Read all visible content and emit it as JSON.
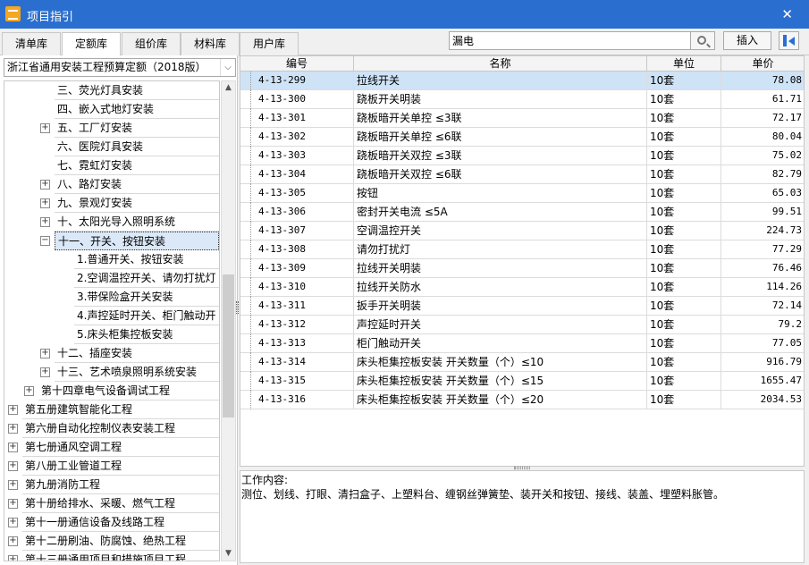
{
  "window": {
    "title": "项目指引"
  },
  "tabs": [
    {
      "label": "清单库",
      "active": false
    },
    {
      "label": "定额库",
      "active": true
    },
    {
      "label": "组价库",
      "active": false
    },
    {
      "label": "材料库",
      "active": false
    },
    {
      "label": "用户库",
      "active": false
    }
  ],
  "search": {
    "value": "漏电"
  },
  "toolbar": {
    "insert_label": "插入"
  },
  "library_select": {
    "value": "浙江省通用安装工程预算定额（2018版）"
  },
  "tree": [
    {
      "label": "三、荧光灯具安装",
      "expander": ""
    },
    {
      "label": "四、嵌入式地灯安装",
      "expander": ""
    },
    {
      "label": "五、工厂灯安装",
      "expander": "+"
    },
    {
      "label": "六、医院灯具安装",
      "expander": ""
    },
    {
      "label": "七、霓虹灯安装",
      "expander": ""
    },
    {
      "label": "八、路灯安装",
      "expander": "+"
    },
    {
      "label": "九、景观灯安装",
      "expander": "+"
    },
    {
      "label": "十、太阳光导入照明系统",
      "expander": "+"
    },
    {
      "label": "十一、开关、按钮安装",
      "expander": "−",
      "selected": true
    },
    {
      "label": "1.普通开关、按钮安装",
      "expander": ""
    },
    {
      "label": "2.空调温控开关、请勿打扰灯",
      "expander": ""
    },
    {
      "label": "3.带保险盒开关安装",
      "expander": ""
    },
    {
      "label": "4.声控延时开关、柜门触动开",
      "expander": ""
    },
    {
      "label": "5.床头柜集控板安装",
      "expander": ""
    },
    {
      "label": "十二、插座安装",
      "expander": "+"
    },
    {
      "label": "十三、艺术喷泉照明系统安装",
      "expander": "+"
    },
    {
      "label": "第十四章电气设备调试工程",
      "expander": "+"
    },
    {
      "label": "第五册建筑智能化工程",
      "expander": "+"
    },
    {
      "label": "第六册自动化控制仪表安装工程",
      "expander": "+"
    },
    {
      "label": "第七册通风空调工程",
      "expander": "+"
    },
    {
      "label": "第八册工业管道工程",
      "expander": "+"
    },
    {
      "label": "第九册消防工程",
      "expander": "+"
    },
    {
      "label": "第十册给排水、采暖、燃气工程",
      "expander": "+"
    },
    {
      "label": "第十一册通信设备及线路工程",
      "expander": "+"
    },
    {
      "label": "第十二册刷油、防腐蚀、绝热工程",
      "expander": "+"
    },
    {
      "label": "第十三册通用项目和措施项目工程",
      "expander": "+"
    }
  ],
  "grid": {
    "columns": [
      "编号",
      "名称",
      "单位",
      "单价"
    ],
    "rows": [
      [
        "4-13-299",
        "拉线开关",
        "10套",
        "78.08"
      ],
      [
        "4-13-300",
        "跷板开关明装",
        "10套",
        "61.71"
      ],
      [
        "4-13-301",
        "跷板暗开关单控 ≤3联",
        "10套",
        "72.17"
      ],
      [
        "4-13-302",
        "跷板暗开关单控 ≤6联",
        "10套",
        "80.04"
      ],
      [
        "4-13-303",
        "跷板暗开关双控 ≤3联",
        "10套",
        "75.02"
      ],
      [
        "4-13-304",
        "跷板暗开关双控 ≤6联",
        "10套",
        "82.79"
      ],
      [
        "4-13-305",
        "按钮",
        "10套",
        "65.03"
      ],
      [
        "4-13-306",
        "密封开关电流 ≤5A",
        "10套",
        "99.51"
      ],
      [
        "4-13-307",
        "空调温控开关",
        "10套",
        "224.73"
      ],
      [
        "4-13-308",
        "请勿打扰灯",
        "10套",
        "77.29"
      ],
      [
        "4-13-309",
        "拉线开关明装",
        "10套",
        "76.46"
      ],
      [
        "4-13-310",
        "拉线开关防水",
        "10套",
        "114.26"
      ],
      [
        "4-13-311",
        "扳手开关明装",
        "10套",
        "72.14"
      ],
      [
        "4-13-312",
        "声控延时开关",
        "10套",
        "79.2"
      ],
      [
        "4-13-313",
        "柜门触动开关",
        "10套",
        "77.05"
      ],
      [
        "4-13-314",
        "床头柜集控板安装 开关数量（个）≤10",
        "10套",
        "916.79"
      ],
      [
        "4-13-315",
        "床头柜集控板安装 开关数量（个）≤15",
        "10套",
        "1655.47"
      ],
      [
        "4-13-316",
        "床头柜集控板安装 开关数量（个）≤20",
        "10套",
        "2034.53"
      ]
    ]
  },
  "work_content": {
    "label": "工作内容:",
    "text": "测位、划线、打眼、清扫盒子、上塑料台、缠钢丝弹簧垫、装开关和按钮、接线、装盖、埋塑料胀管。"
  },
  "colors": {
    "titlebar": "#2a6fcf",
    "selection": "#cfe3f7"
  }
}
